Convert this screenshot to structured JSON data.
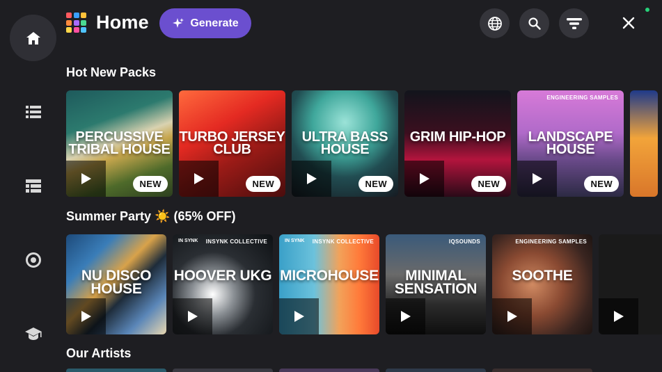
{
  "header": {
    "title": "Home",
    "generate_label": "Generate",
    "logo_colors": [
      "#ff5a5f",
      "#3aa0ff",
      "#ffc23a",
      "#ff8a3d",
      "#a86bff",
      "#4ad991",
      "#ffd84a",
      "#ff4fa1",
      "#4fc3ff"
    ]
  },
  "sidebar": {
    "items": [
      {
        "name": "home",
        "icon": "home-icon",
        "active": true
      },
      {
        "name": "list",
        "icon": "list-icon"
      },
      {
        "name": "browse",
        "icon": "table-list-icon"
      },
      {
        "name": "target",
        "icon": "target-icon"
      },
      {
        "name": "learn",
        "icon": "graduation-cap-icon"
      }
    ]
  },
  "sections": {
    "hot_new_packs": {
      "title": "Hot New Packs",
      "cards": [
        {
          "label": "PERCUSSIVE TRIBAL HOUSE",
          "badge": "NEW",
          "bg": "linear-gradient(160deg,#1e5a5c 0%,#2c7a6e 30%,#d9d2b0 48%,#c7a64d 58%,#4e6a2a 78%,#2d3f1f 100%)"
        },
        {
          "label": "TURBO JERSEY CLUB",
          "badge": "NEW",
          "bg": "linear-gradient(150deg,#ff6a3d 0%,#e42a22 35%,#9c1b17 60%,#4a0d0d 100%)"
        },
        {
          "label": "ULTRA BASS HOUSE",
          "badge": "NEW",
          "bg": "radial-gradient(circle at 50% 30%,#9be3d8 0%,#3fa79b 35%,#214d52 60%,#161b22 100%)"
        },
        {
          "label": "GRIM HIP-HOP",
          "badge": "NEW",
          "bg": "linear-gradient(180deg,#12141c 0%,#3b0f1f 40%,#b3143d 65%,#2a0a18 100%)"
        },
        {
          "label": "LANDSCAPE HOUSE",
          "badge": "NEW",
          "brand": "ENGINEERING SAMPLES",
          "bg": "linear-gradient(180deg,#d77ad8 0%,#b06ac9 40%,#6a4a8a 65%,#2c2a44 100%)"
        }
      ]
    },
    "summer_party": {
      "title": "Summer Party ☀️ (65% OFF)",
      "cards": [
        {
          "label": "NU DISCO HOUSE",
          "bg": "linear-gradient(135deg,#1d4a7a 0%,#3a7db8 25%,#d8a24a 45%,#1e2c3a 60%,#5a86b8 80%,#e8d7b0 100%)"
        },
        {
          "label": "HOOVER UKG",
          "brand": "INSYNK COLLECTIVE",
          "logo": "IN SYNK",
          "bg": "radial-gradient(circle at 40% 60%,#ffffff 0%,#8a8f94 25%,#2a2e33 50%,#0e1114 100%)"
        },
        {
          "label": "MICROHOUSE",
          "brand": "INSYNK COLLECTIVE",
          "logo": "IN SYNK",
          "bg": "linear-gradient(90deg,#3aa0c8 0%,#6cc2dc 35%,#f2a25a 60%,#ff7a3a 80%,#e84a2a 100%)"
        },
        {
          "label": "MINIMAL SENSATION",
          "brand": "IQSOUNDS",
          "bg": "linear-gradient(180deg,#3a5a7a 0%,#6a6a6a 40%,#2b2b2b 70%,#0e0e0e 100%)"
        },
        {
          "label": "SOOTHE",
          "brand": "ENGINEERING SAMPLES",
          "bg": "radial-gradient(circle at 40% 50%,#d08a62 0%,#8a4a32 40%,#3a2520 75%,#1c1412 100%)"
        },
        {
          "label": "",
          "bg": "#1a1a1a"
        }
      ]
    },
    "our_artists": {
      "title": "Our Artists"
    }
  }
}
